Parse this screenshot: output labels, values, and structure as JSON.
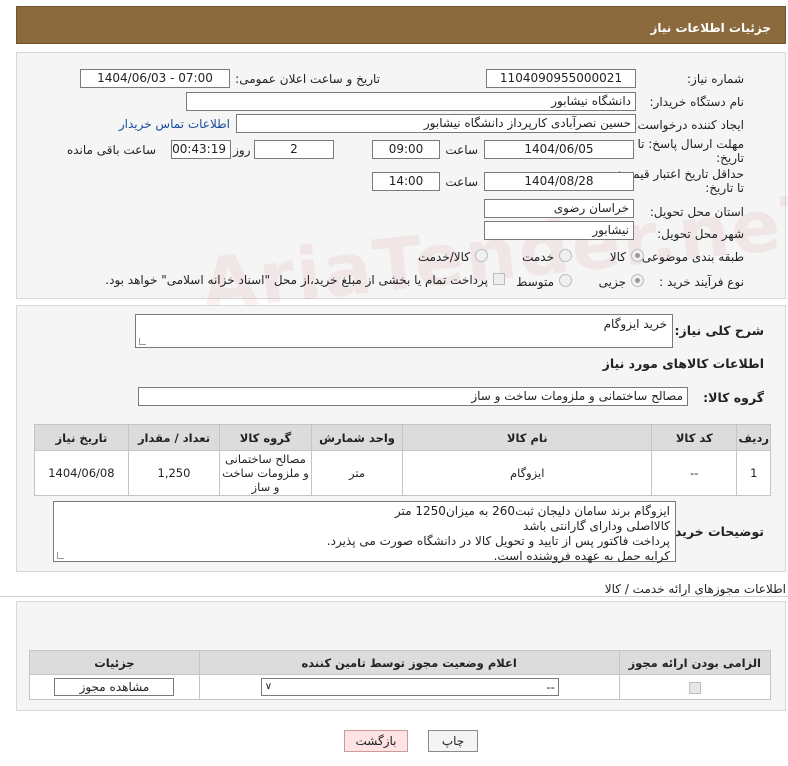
{
  "header": {
    "title": "جزئیات اطلاعات نیاز"
  },
  "form": {
    "need_number_label": "شماره نیاز:",
    "need_number": "1104090955000021",
    "announce_label": "تاریخ و ساعت اعلان عمومی:",
    "announce_value": "1404/06/03 - 07:00",
    "buyer_org_label": "نام دستگاه خریدار:",
    "buyer_org": "دانشگاه نیشابور",
    "creator_label": "ایجاد کننده درخواست:",
    "creator": "حسین نصرآبادی کارپرداز دانشگاه نیشابور",
    "contact_link": "اطلاعات تماس خریدار",
    "deadline_label_1": "مهلت ارسال پاسخ: تا",
    "deadline_label_2": "تاریخ:",
    "deadline_date": "1404/06/05",
    "time_label": "ساعت",
    "deadline_time": "09:00",
    "days_value": "2",
    "days_label": "روز و",
    "remaining_time": "00:43:19",
    "remaining_label": "ساعت باقی مانده",
    "validity_label_1": "حداقل تاریخ اعتبار قیمت:",
    "validity_label_2": "تا تاریخ:",
    "validity_date": "1404/08/28",
    "validity_time": "14:00",
    "province_label": "استان محل تحویل:",
    "province": "خراسان رضوی",
    "city_label": "شهر محل تحویل:",
    "city": "نیشابور",
    "category_label": "طبقه بندی موضوعی:",
    "category_options": [
      "کالا",
      "خدمت",
      "کالا/خدمت"
    ],
    "process_label": "نوع فرآیند خرید :",
    "process_options": [
      "جزیی",
      "متوسط"
    ],
    "payment_note": "پرداخت تمام یا بخشی از مبلغ خرید،از محل \"اسناد خزانه اسلامی\" خواهد بود."
  },
  "description": {
    "label": "شرح کلی نیاز:",
    "value": "خرید ایزوگام"
  },
  "goods": {
    "section_title": "اطلاعات کالاهای مورد نیاز",
    "group_label": "گروه کالا:",
    "group_value": "مصالح ساختمانی و ملزومات ساخت و ساز",
    "columns": [
      "ردیف",
      "کد کالا",
      "نام کالا",
      "واحد شمارش",
      "گروه کالا",
      "تعداد / مقدار",
      "تاریخ نیاز"
    ],
    "rows": [
      {
        "row": "1",
        "code": "--",
        "name": "ایزوگام",
        "unit": "متر",
        "group": "مصالح ساختمانی و ملزومات ساخت و ساز",
        "qty": "1,250",
        "date": "1404/06/08"
      }
    ]
  },
  "buyer_notes": {
    "label": "توضیحات خریدار:",
    "lines": [
      "ایزوگام برند سامان دلیجان ثبت260 به میزان1250 متر",
      "کالااصلی ودارای گارانتی باشد",
      "پرداخت فاکتور پس از تایید و تحویل کالا در دانشگاه صورت می پذیرد.",
      "کرایه حمل به عهده فروشنده است."
    ]
  },
  "permits": {
    "section_title": "اطلاعات مجوزهای ارائه خدمت / کالا",
    "columns": [
      "الزامی بودن ارائه مجوز",
      "اعلام وضعیت مجوز توسط تامین کننده",
      "جزئیات"
    ],
    "select_value": "--",
    "view_button": "مشاهده مجوز"
  },
  "actions": {
    "print": "چاپ",
    "back": "بازگشت"
  },
  "watermark": "AriaTender.neT"
}
